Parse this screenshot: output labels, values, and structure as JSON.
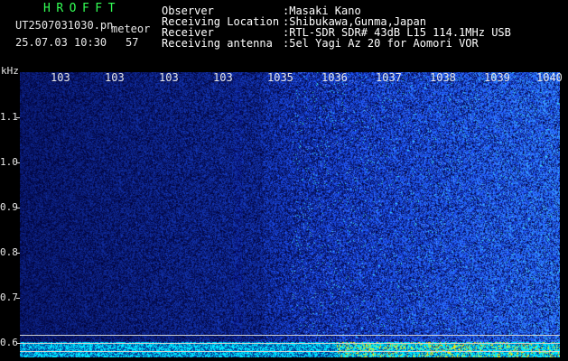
{
  "header": {
    "brand": "HROFFT",
    "filename": "UT2507031030.pn",
    "mode": "meteor",
    "datetime": "25.07.03 10:30",
    "count": "57"
  },
  "meta": {
    "labels": [
      "Observer",
      "Receiving Location",
      "Receiver",
      "Receiving antenna"
    ],
    "values": [
      ":Masaki Kano",
      ":Shibukawa,Gunma,Japan",
      ":RTL-SDR SDR# 43dB L15 114.1MHz USB",
      ":5el Yagi Az 20 for Aomori VOR"
    ]
  },
  "axes": {
    "y_unit": "kHz",
    "y_ticks": [
      "1.1",
      "1.0",
      "0.9",
      "0.8",
      "0.7",
      "0.6"
    ],
    "x_ticks": [
      "103",
      "103",
      "103",
      "103",
      "1035",
      "1036",
      "1037",
      "1038",
      "1039",
      "1040"
    ]
  },
  "colors": {
    "background": "#000000",
    "brand": "#33ff55",
    "text": "#e8e8e8",
    "noise_low": "#050a4a",
    "noise_high": "#3355ff",
    "signal": "#33ffee",
    "baseline": "#00ffff",
    "baseline_peak": "#ffff00"
  }
}
